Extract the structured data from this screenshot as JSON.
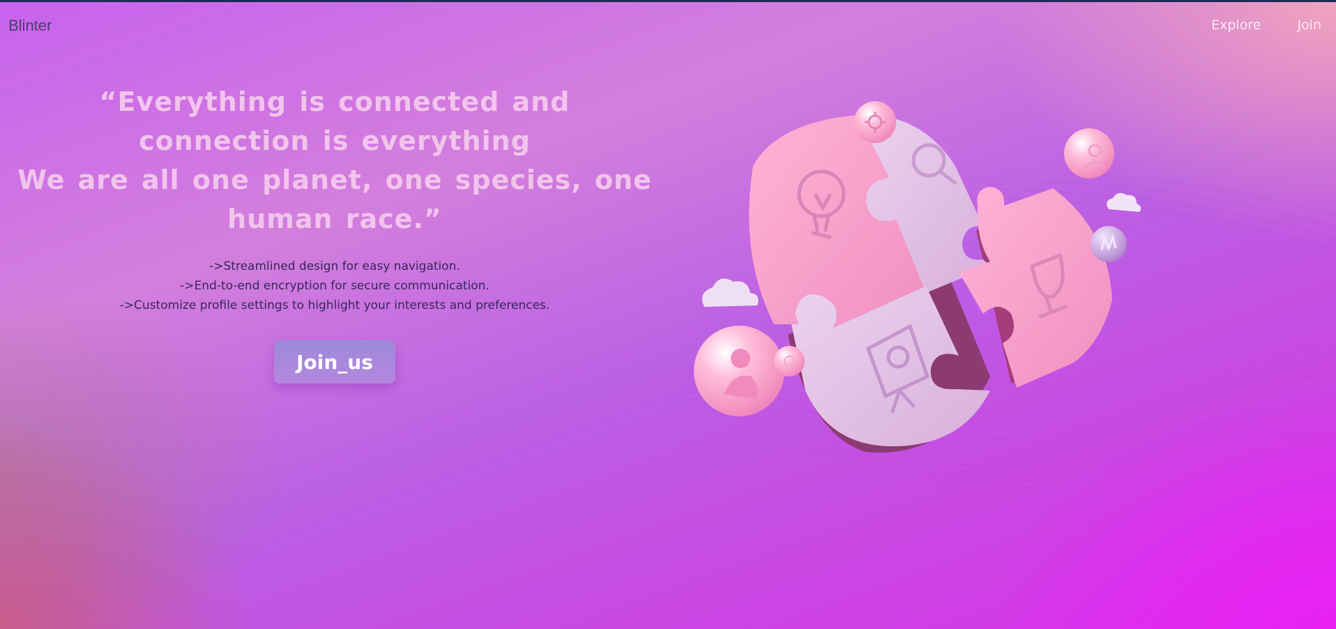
{
  "navbar": {
    "brand": "Blinter",
    "links": [
      "Explore",
      "Join"
    ]
  },
  "hero": {
    "quote_line1": "“Everything is connected and connection is everything",
    "quote_line2": "We are all one planet, one species, one human race.”",
    "features": [
      "->Streamlined design for easy navigation.",
      "->End-to-end encryption for secure communication.",
      "->Customize profile settings to highlight your interests and preferences."
    ],
    "cta_label": "Join_us"
  },
  "colors": {
    "brand_text": "#4a3e6e",
    "quote_text": "#f2c4ec",
    "feature_text": "#36275a",
    "nav_link": "#fbe9f5",
    "button": "#a98ad9",
    "puzzle_pink": "#f6a6cd",
    "puzzle_lavender": "#e1c0e4"
  },
  "illustration": {
    "icons": [
      "lightbulb-icon",
      "magnifier-icon",
      "trophy-icon",
      "presentation-icon",
      "user-icon",
      "settings-icon",
      "chart-icon",
      "cloud-icon"
    ]
  }
}
